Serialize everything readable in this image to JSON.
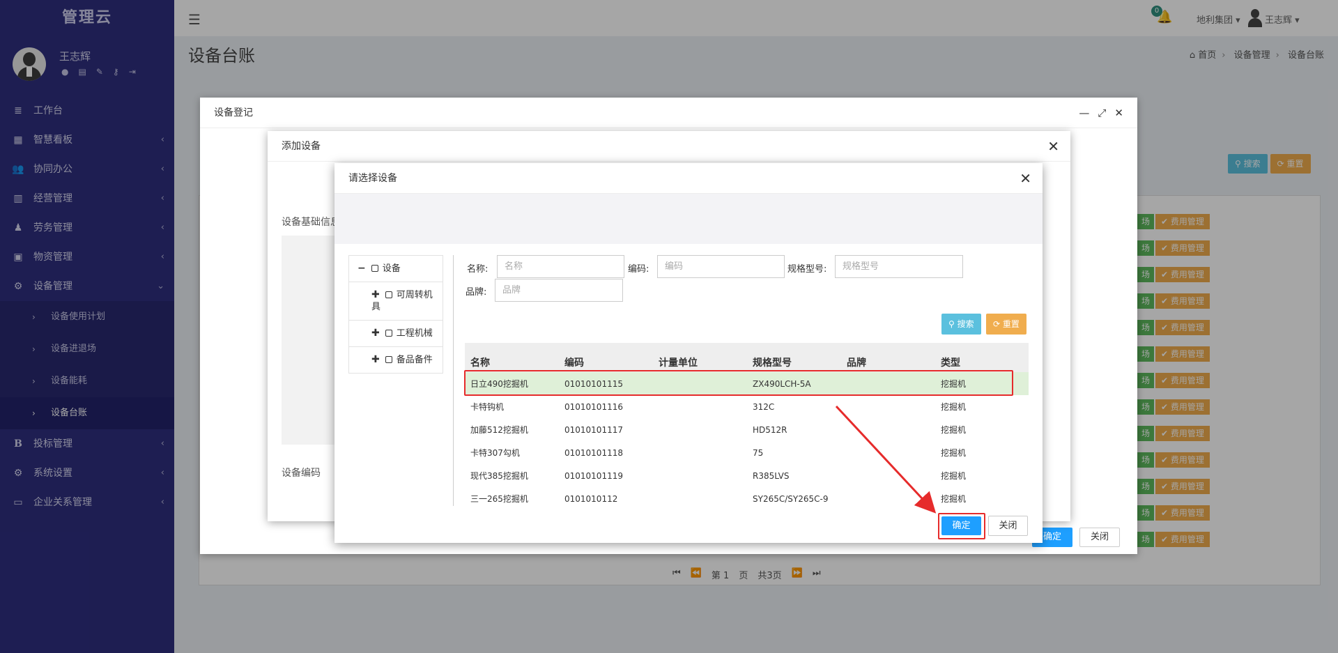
{
  "app": {
    "brand": "管理云"
  },
  "user": {
    "name": "王志辉"
  },
  "sidebar": {
    "items": [
      {
        "label": "工作台",
        "icon": "≣"
      },
      {
        "label": "智慧看板",
        "icon": "▦"
      },
      {
        "label": "协同办公",
        "icon": "👥"
      },
      {
        "label": "经营管理",
        "icon": "▥"
      },
      {
        "label": "劳务管理",
        "icon": "♟"
      },
      {
        "label": "物资管理",
        "icon": "▣"
      },
      {
        "label": "设备管理",
        "icon": "⚙"
      }
    ],
    "subitems": [
      {
        "label": "设备使用计划"
      },
      {
        "label": "设备进退场"
      },
      {
        "label": "设备能耗"
      },
      {
        "label": "设备台账"
      }
    ],
    "items2": [
      {
        "label": "投标管理",
        "icon": "B"
      },
      {
        "label": "系统设置",
        "icon": "⚙"
      },
      {
        "label": "企业关系管理",
        "icon": "▭"
      }
    ]
  },
  "topbar": {
    "bell_count": "0",
    "org": "地利集团",
    "user": "王志辉"
  },
  "page": {
    "title": "设备台账",
    "breadcrumb": [
      "首页",
      "设备管理",
      "设备台账"
    ]
  },
  "background": {
    "search_label": "搜索",
    "reset_label": "重置",
    "rows_green": "场",
    "rows_orange": "费用管理",
    "pager": {
      "page_prefix": "第",
      "page": "1",
      "page_suffix": "页",
      "total": "共3页"
    }
  },
  "dialog1": {
    "title": "设备登记",
    "ok": "确定",
    "close": "关闭"
  },
  "dialog2": {
    "title": "添加设备",
    "section1": "设备基础信息",
    "section2": "设备编码"
  },
  "dialog3": {
    "title": "请选择设备",
    "tree": [
      {
        "sym": "−",
        "label": "设备"
      },
      {
        "sym": "✚",
        "label": "可周转机具"
      },
      {
        "sym": "✚",
        "label": "工程机械"
      },
      {
        "sym": "✚",
        "label": "备品备件"
      }
    ],
    "filters": {
      "name_label": "名称:",
      "name_placeholder": "名称",
      "code_label": "编码:",
      "code_placeholder": "编码",
      "model_label": "规格型号:",
      "model_placeholder": "规格型号",
      "brand_label": "品牌:",
      "brand_placeholder": "品牌"
    },
    "search_btn": "搜索",
    "reset_btn": "重置",
    "columns": [
      "名称",
      "编码",
      "计量单位",
      "规格型号",
      "品牌",
      "类型"
    ],
    "rows": [
      {
        "name": "日立490挖掘机",
        "code": "01010101115",
        "unit": "",
        "model": "ZX490LCH-5A",
        "brand": "",
        "type": "挖掘机"
      },
      {
        "name": "卡特钩机",
        "code": "01010101116",
        "unit": "",
        "model": "312C",
        "brand": "",
        "type": "挖掘机"
      },
      {
        "name": "加藤512挖掘机",
        "code": "01010101117",
        "unit": "",
        "model": "HD512R",
        "brand": "",
        "type": "挖掘机"
      },
      {
        "name": "卡特307勾机",
        "code": "01010101118",
        "unit": "",
        "model": "75",
        "brand": "",
        "type": "挖掘机"
      },
      {
        "name": "现代385挖掘机",
        "code": "01010101119",
        "unit": "",
        "model": "R385LVS",
        "brand": "",
        "type": "挖掘机"
      },
      {
        "name": "三一265挖掘机",
        "code": "0101010112",
        "unit": "",
        "model": "SY265C/SY265C-9",
        "brand": "",
        "type": "挖掘机"
      }
    ],
    "ok": "确定",
    "close": "关闭"
  },
  "colors": {
    "sidebar": "#2e2e7f",
    "primary": "#1e9fff",
    "info": "#5bc0de",
    "warning": "#f0ad4e",
    "success": "#5cb85c",
    "highlight": "#e62b2b"
  }
}
